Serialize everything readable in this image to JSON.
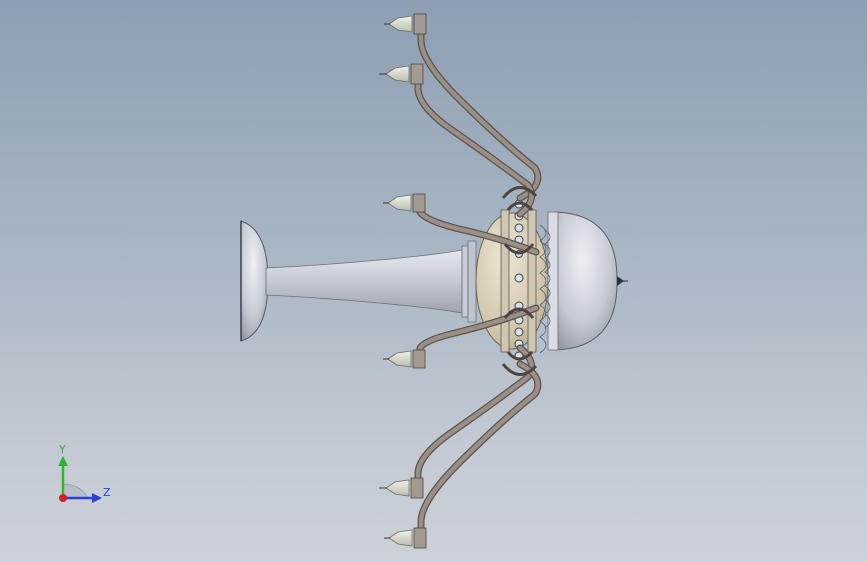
{
  "viewport": {
    "background_top": "#8e9fb3",
    "background_bottom": "#cdd2d8"
  },
  "triad": {
    "y_label": "Y",
    "z_label": "Z",
    "y_color": "#2fb52f",
    "z_color": "#2a3fd6",
    "x_color": "#d42020"
  },
  "model": {
    "metal_color": "#8b7d74",
    "body_color": "#c9ccd4",
    "collar_color": "#d6cdb9"
  }
}
